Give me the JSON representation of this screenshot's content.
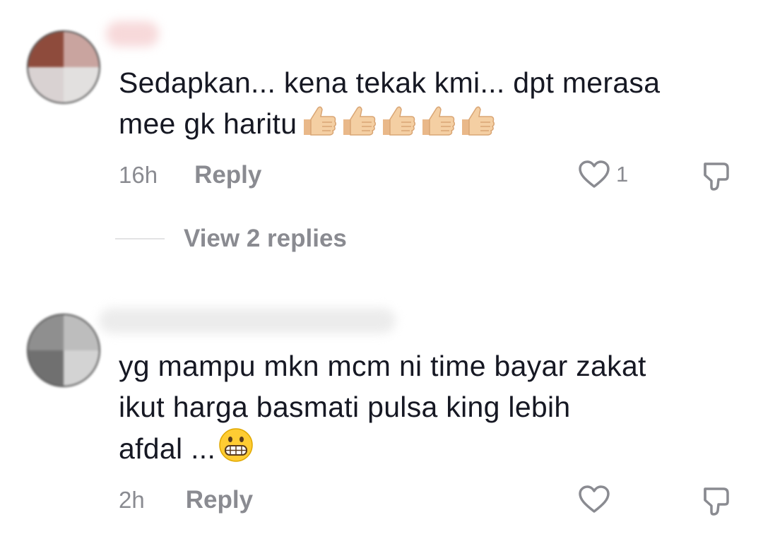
{
  "comments": [
    {
      "text": "Sedapkan... kena tekak kmi... dpt merasa\nmee gk haritu",
      "emojis": [
        "thumbs-up",
        "thumbs-up",
        "thumbs-up",
        "thumbs-up",
        "thumbs-up"
      ],
      "time": "16h",
      "reply_label": "Reply",
      "likes": "1",
      "view_replies": "View 2 replies",
      "avatar_colors": [
        "#8e4b3c",
        "#c9a49f",
        "#d9d2d2",
        "#e2e0df"
      ]
    },
    {
      "text": "yg mampu mkn mcm ni time bayar zakat\nikut harga basmati pulsa king lebih\nafdal ...",
      "emojis": [
        "grinning-face"
      ],
      "time": "2h",
      "reply_label": "Reply",
      "likes": "",
      "avatar_colors": [
        "#8f8f8f",
        "#bdbdbd",
        "#707070",
        "#d3d3d3"
      ]
    }
  ],
  "colors": {
    "text": "#161823",
    "muted": "#8a8b91",
    "thumb_skin": "#f4cfa3",
    "emoji_yellow": "#ffcc33"
  }
}
